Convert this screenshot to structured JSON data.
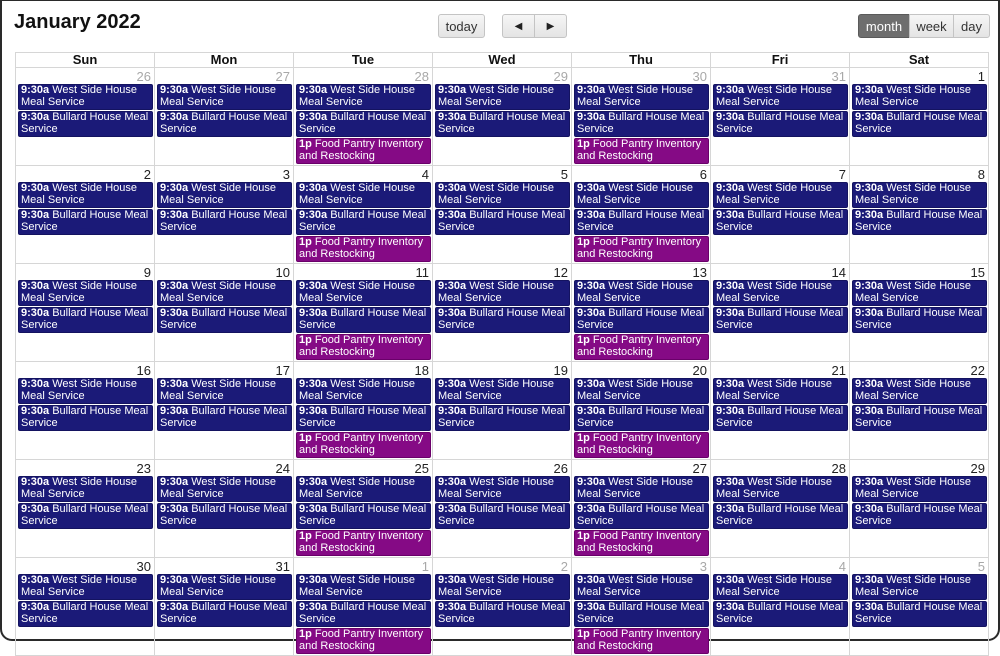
{
  "header": {
    "title": "January 2022",
    "today_label": "today",
    "prev_icon": "◀",
    "next_icon": "▶",
    "views": [
      {
        "label": "month",
        "active": true
      },
      {
        "label": "week",
        "active": false
      },
      {
        "label": "day",
        "active": false
      }
    ]
  },
  "colors": {
    "meal_service": "#1b1a78",
    "food_pantry": "#850a85",
    "active_view": "#6e6e6e"
  },
  "weekdays": [
    "Sun",
    "Mon",
    "Tue",
    "Wed",
    "Thu",
    "Fri",
    "Sat"
  ],
  "event_templates": {
    "west_side": {
      "time": "9:30a",
      "title": "West Side House Meal Service",
      "color": "navy"
    },
    "bullard": {
      "time": "9:30a",
      "title": "Bullard House Meal Service",
      "color": "navy"
    },
    "pantry": {
      "time": "1p",
      "title": "Food Pantry Inventory and Restocking",
      "color": "purple"
    }
  },
  "weeks": [
    [
      {
        "day": "26",
        "other": true,
        "events": [
          "west_side",
          "bullard"
        ]
      },
      {
        "day": "27",
        "other": true,
        "events": [
          "west_side",
          "bullard"
        ]
      },
      {
        "day": "28",
        "other": true,
        "events": [
          "west_side",
          "bullard",
          "pantry"
        ]
      },
      {
        "day": "29",
        "other": true,
        "events": [
          "west_side",
          "bullard"
        ]
      },
      {
        "day": "30",
        "other": true,
        "events": [
          "west_side",
          "bullard",
          "pantry"
        ]
      },
      {
        "day": "31",
        "other": true,
        "events": [
          "west_side",
          "bullard"
        ]
      },
      {
        "day": "1",
        "other": false,
        "events": [
          "west_side",
          "bullard"
        ]
      }
    ],
    [
      {
        "day": "2",
        "other": false,
        "events": [
          "west_side",
          "bullard"
        ]
      },
      {
        "day": "3",
        "other": false,
        "events": [
          "west_side",
          "bullard"
        ]
      },
      {
        "day": "4",
        "other": false,
        "events": [
          "west_side",
          "bullard",
          "pantry"
        ]
      },
      {
        "day": "5",
        "other": false,
        "events": [
          "west_side",
          "bullard"
        ]
      },
      {
        "day": "6",
        "other": false,
        "events": [
          "west_side",
          "bullard",
          "pantry"
        ]
      },
      {
        "day": "7",
        "other": false,
        "events": [
          "west_side",
          "bullard"
        ]
      },
      {
        "day": "8",
        "other": false,
        "events": [
          "west_side",
          "bullard"
        ]
      }
    ],
    [
      {
        "day": "9",
        "other": false,
        "events": [
          "west_side",
          "bullard"
        ]
      },
      {
        "day": "10",
        "other": false,
        "events": [
          "west_side",
          "bullard"
        ]
      },
      {
        "day": "11",
        "other": false,
        "events": [
          "west_side",
          "bullard",
          "pantry"
        ]
      },
      {
        "day": "12",
        "other": false,
        "events": [
          "west_side",
          "bullard"
        ]
      },
      {
        "day": "13",
        "other": false,
        "events": [
          "west_side",
          "bullard",
          "pantry"
        ]
      },
      {
        "day": "14",
        "other": false,
        "events": [
          "west_side",
          "bullard"
        ]
      },
      {
        "day": "15",
        "other": false,
        "events": [
          "west_side",
          "bullard"
        ]
      }
    ],
    [
      {
        "day": "16",
        "other": false,
        "events": [
          "west_side",
          "bullard"
        ]
      },
      {
        "day": "17",
        "other": false,
        "events": [
          "west_side",
          "bullard"
        ]
      },
      {
        "day": "18",
        "other": false,
        "events": [
          "west_side",
          "bullard",
          "pantry"
        ]
      },
      {
        "day": "19",
        "other": false,
        "events": [
          "west_side",
          "bullard"
        ]
      },
      {
        "day": "20",
        "other": false,
        "events": [
          "west_side",
          "bullard",
          "pantry"
        ]
      },
      {
        "day": "21",
        "other": false,
        "events": [
          "west_side",
          "bullard"
        ]
      },
      {
        "day": "22",
        "other": false,
        "events": [
          "west_side",
          "bullard"
        ]
      }
    ],
    [
      {
        "day": "23",
        "other": false,
        "events": [
          "west_side",
          "bullard"
        ]
      },
      {
        "day": "24",
        "other": false,
        "events": [
          "west_side",
          "bullard"
        ]
      },
      {
        "day": "25",
        "other": false,
        "events": [
          "west_side",
          "bullard",
          "pantry"
        ]
      },
      {
        "day": "26",
        "other": false,
        "events": [
          "west_side",
          "bullard"
        ]
      },
      {
        "day": "27",
        "other": false,
        "events": [
          "west_side",
          "bullard",
          "pantry"
        ]
      },
      {
        "day": "28",
        "other": false,
        "events": [
          "west_side",
          "bullard"
        ]
      },
      {
        "day": "29",
        "other": false,
        "events": [
          "west_side",
          "bullard"
        ]
      }
    ],
    [
      {
        "day": "30",
        "other": false,
        "events": [
          "west_side",
          "bullard"
        ]
      },
      {
        "day": "31",
        "other": false,
        "events": [
          "west_side",
          "bullard"
        ]
      },
      {
        "day": "1",
        "other": true,
        "events": [
          "west_side",
          "bullard",
          "pantry"
        ]
      },
      {
        "day": "2",
        "other": true,
        "events": [
          "west_side",
          "bullard"
        ]
      },
      {
        "day": "3",
        "other": true,
        "events": [
          "west_side",
          "bullard",
          "pantry"
        ]
      },
      {
        "day": "4",
        "other": true,
        "events": [
          "west_side",
          "bullard"
        ]
      },
      {
        "day": "5",
        "other": true,
        "events": [
          "west_side",
          "bullard"
        ]
      }
    ]
  ]
}
